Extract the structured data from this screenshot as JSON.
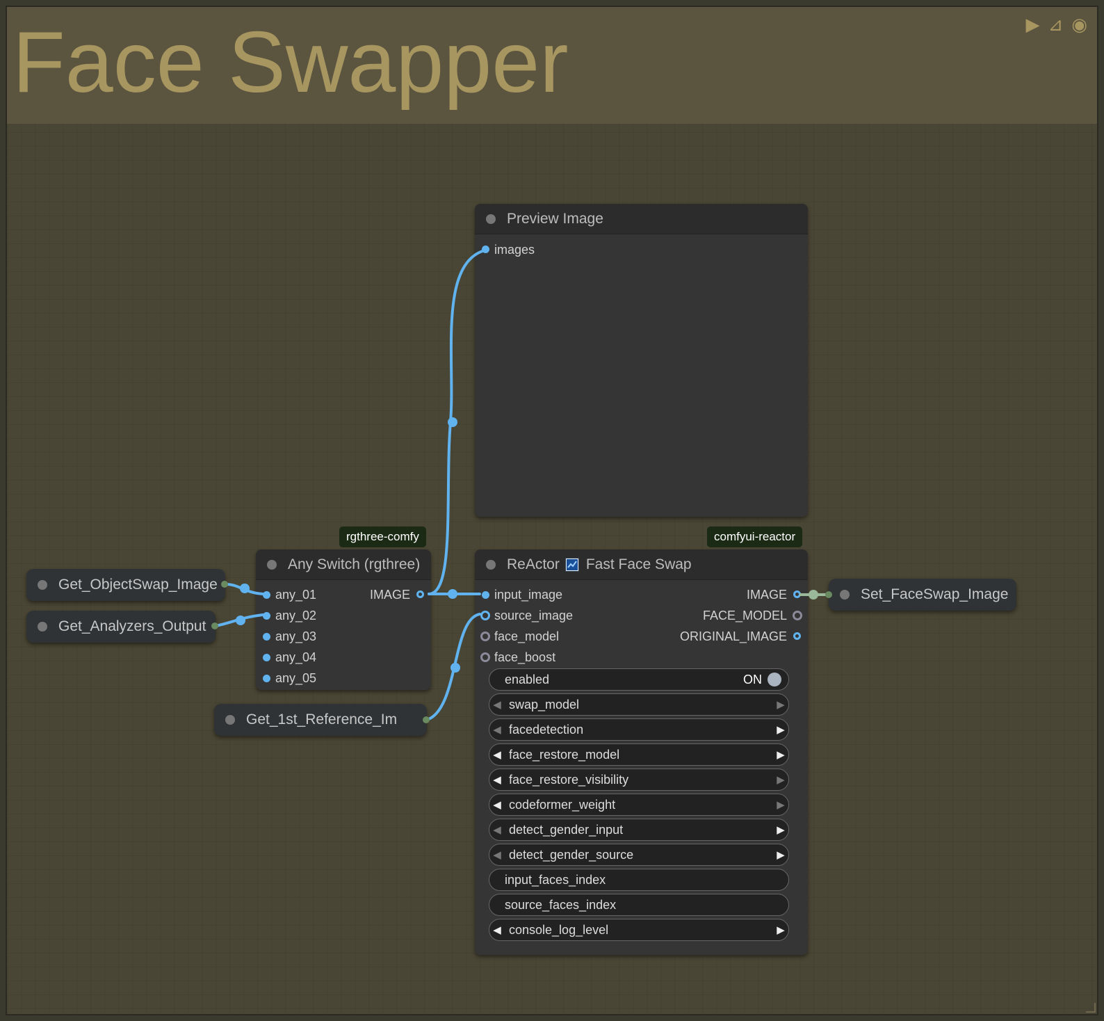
{
  "group": {
    "title": "Face Swapper",
    "icons": [
      "play-icon",
      "pin-icon",
      "eye-icon"
    ]
  },
  "badges": {
    "rgthree": "rgthree-comfy",
    "reactor": "comfyui-reactor"
  },
  "preview_node": {
    "title": "Preview Image",
    "inputs": [
      "images"
    ]
  },
  "switch_node": {
    "title": "Any Switch (rgthree)",
    "inputs": [
      "any_01",
      "any_02",
      "any_03",
      "any_04",
      "any_05"
    ],
    "output": "IMAGE"
  },
  "reactor_node": {
    "title_prefix": "ReActor",
    "title_suffix": "Fast Face Swap",
    "inputs": [
      "input_image",
      "source_image",
      "face_model",
      "face_boost"
    ],
    "outputs": [
      "IMAGE",
      "FACE_MODEL",
      "ORIGINAL_IMAGE"
    ],
    "widgets": {
      "enabled": {
        "label": "enabled",
        "value": "ON"
      },
      "swap_model": "swap_model",
      "facedetection": "facedetection",
      "face_restore_model": "face_restore_model",
      "face_restore_visibility": "face_restore_visibility",
      "codeformer_weight": "codeformer_weight",
      "detect_gender_input": "detect_gender_input",
      "detect_gender_source": "detect_gender_source",
      "input_faces_index": "input_faces_index",
      "source_faces_index": "source_faces_index",
      "console_log_level": "console_log_level"
    }
  },
  "get_nodes": {
    "object_swap": "Get_ObjectSwap_Image",
    "analyzers": "Get_Analyzers_Output",
    "reference": "Get_1st_Reference_Im"
  },
  "set_node": {
    "label": "Set_FaceSwap_Image"
  },
  "colors": {
    "image_link": "#61b3f0",
    "group_title": "#a89660",
    "group_bg": "#4a4635",
    "node_bg": "#353535",
    "badge_bg": "#1b2a15",
    "setget_dot": "#6a8a60"
  }
}
